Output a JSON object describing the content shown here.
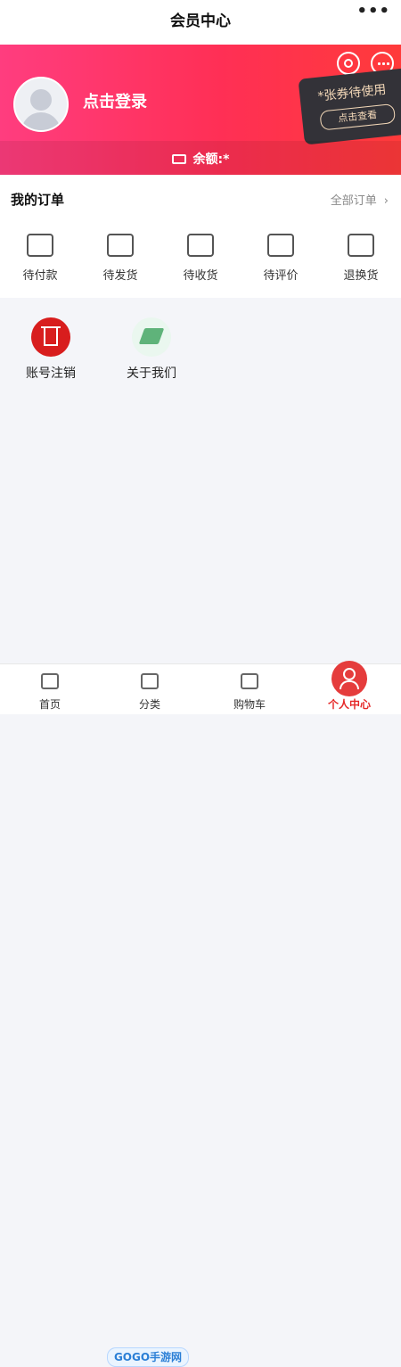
{
  "header": {
    "title": "会员中心",
    "more_label": "•••"
  },
  "banner": {
    "login_text": "点击登录",
    "coupon": {
      "text": "*张券待使用",
      "button_label": "点击查看"
    },
    "balance_text": "余额:*"
  },
  "orders": {
    "title": "我的订单",
    "all_label": "全部订单",
    "items": [
      {
        "label": "待付款",
        "icon": "wallet-icon"
      },
      {
        "label": "待发货",
        "icon": "package-icon"
      },
      {
        "label": "待收货",
        "icon": "truck-icon"
      },
      {
        "label": "待评价",
        "icon": "review-icon"
      },
      {
        "label": "退换货",
        "icon": "return-icon"
      }
    ]
  },
  "tools": [
    {
      "label": "账号注销",
      "icon": "trash-icon"
    },
    {
      "label": "关于我们",
      "icon": "chip-icon"
    }
  ],
  "tabbar": {
    "items": [
      {
        "label": "首页",
        "icon": "home-icon"
      },
      {
        "label": "分类",
        "icon": "grid-icon"
      },
      {
        "label": "购物车",
        "icon": "cart-icon"
      },
      {
        "label": "个人中心",
        "icon": "user-icon"
      }
    ],
    "active_index": 3,
    "watermark": "GOGO手游网"
  },
  "colors": {
    "brand": "#ff3a58",
    "active": "#e52828"
  }
}
